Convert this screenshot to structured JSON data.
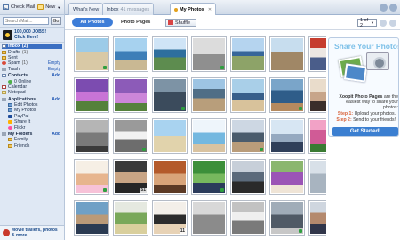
{
  "sidebar": {
    "check_mail": "Check Mail",
    "new_label": "New",
    "search_placeholder": "Search Mail...",
    "go_label": "Go",
    "storage_line1": "100,000 JOBS!",
    "storage_line2": "Click Here!",
    "items": [
      {
        "label": "Inbox",
        "count": "(2)",
        "action": "",
        "icon": "envelope-icon",
        "selected": true
      },
      {
        "label": "Drafts",
        "count": "(1)",
        "action": "",
        "icon": "folder-icon"
      },
      {
        "label": "Sent",
        "count": "",
        "action": "",
        "icon": "folder-icon"
      },
      {
        "label": "Spam",
        "count": "(1)",
        "action": "Empty",
        "icon": "spam-icon"
      },
      {
        "label": "Trash",
        "count": "",
        "action": "Empty",
        "icon": "trash-icon"
      }
    ],
    "contacts": {
      "label": "Contacts",
      "action": "Add",
      "sub": "0 Online"
    },
    "calendar": "Calendar",
    "notepad": "Notepad",
    "applications": {
      "label": "Applications",
      "action": "Add",
      "items": [
        "Edit Photos",
        "My Photos",
        "PayPal",
        "Share It",
        "Flickr"
      ]
    },
    "folders": {
      "label": "My Folders",
      "action": "Add",
      "items": [
        "Family",
        "Friends"
      ]
    },
    "promo": "Movie trailers, photos & more."
  },
  "tabs": [
    {
      "label": "What's New",
      "sub": ""
    },
    {
      "label": "Inbox",
      "sub": "41 messages"
    },
    {
      "label": "My Photos",
      "sub": ""
    }
  ],
  "photo_toolbar": {
    "all_photos": "All Photos",
    "photo_pages": "Photo Pages",
    "shuffle": "Shuffle",
    "page_value": "1 of 2"
  },
  "photos": [
    {
      "badge": ""
    },
    {
      "badge": ""
    },
    {
      "badge": ""
    },
    {
      "badge": ""
    },
    {
      "badge": ""
    },
    {
      "badge": ""
    },
    {
      "badge": ""
    },
    {
      "badge": ""
    },
    {
      "badge": ""
    },
    {
      "badge": ""
    },
    {
      "badge": ""
    },
    {
      "badge": ""
    },
    {
      "badge": ""
    },
    {
      "badge": ""
    },
    {
      "badge": ""
    },
    {
      "badge": ""
    },
    {
      "badge": ""
    },
    {
      "badge": ""
    },
    {
      "badge": ""
    },
    {
      "badge": ""
    },
    {
      "badge": ""
    },
    {
      "badge": ""
    },
    {
      "badge": "51"
    },
    {
      "badge": ""
    },
    {
      "badge": ""
    },
    {
      "badge": ""
    },
    {
      "badge": ""
    },
    {
      "badge": ""
    },
    {
      "badge": ""
    },
    {
      "badge": ""
    },
    {
      "badge": "11"
    },
    {
      "badge": ""
    },
    {
      "badge": ""
    },
    {
      "badge": ""
    },
    {
      "badge": "41"
    }
  ],
  "promo_panel": {
    "title": "Share Your Photos",
    "desc_brand": "Xoopit Photo Pages",
    "desc_rest": "are the easiest way to share your photos:",
    "step1_label": "Step 1:",
    "step1_text": "Upload your photos.",
    "step2_label": "Step 2:",
    "step2_text": "Send to your friends!",
    "cta": "Get Started!"
  },
  "colors": {
    "accent": "#3d7dd8",
    "selected": "#3b6fc2",
    "promo_title": "#7cc0e8",
    "step_label": "#d8623a"
  }
}
